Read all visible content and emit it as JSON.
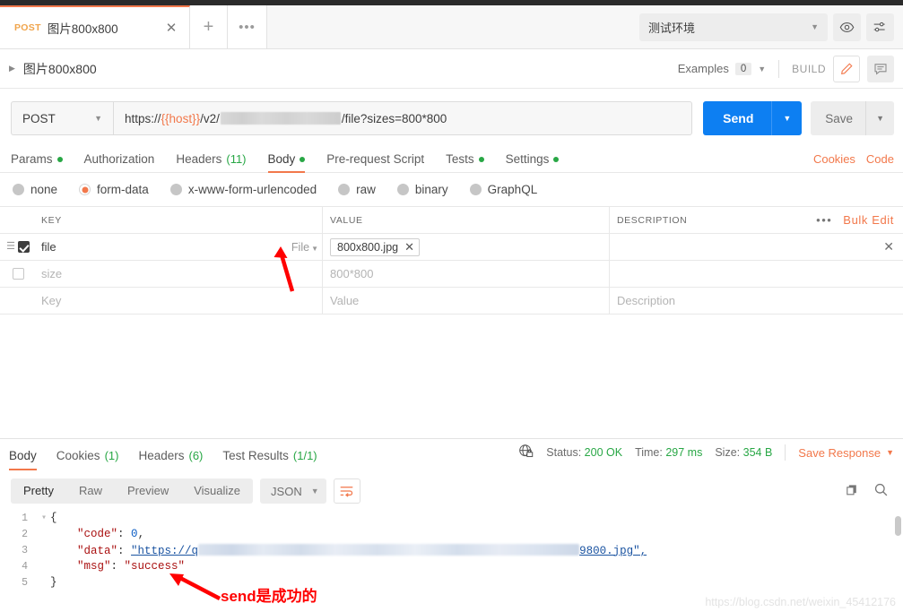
{
  "window": {
    "tab": {
      "method": "POST",
      "title": "图片800x800",
      "close_icon": "close-icon",
      "new_tab_icon": "plus-icon",
      "more_icon": "ellipsis-icon"
    },
    "environment": {
      "selected": "测试环境",
      "eye_icon": "eye-icon",
      "settings_icon": "sliders-icon"
    }
  },
  "breadcrumb": {
    "label": "图片800x800",
    "examples_label": "Examples",
    "examples_count": "0",
    "build_label": "BUILD",
    "edit_icon": "pencil-icon",
    "comment_icon": "comment-icon"
  },
  "request": {
    "method": "POST",
    "url_prefix": "https://",
    "url_var": "{{host}}",
    "url_mid": "/v2/",
    "url_suffix": "/file?sizes=800*800",
    "send_label": "Send",
    "save_label": "Save",
    "tabs": [
      {
        "label": "Params",
        "dot": true,
        "count": "",
        "active": false
      },
      {
        "label": "Authorization",
        "dot": false,
        "count": "",
        "active": false
      },
      {
        "label": "Headers",
        "dot": false,
        "count": "(11)",
        "active": false
      },
      {
        "label": "Body",
        "dot": true,
        "count": "",
        "active": true
      },
      {
        "label": "Pre-request Script",
        "dot": false,
        "count": "",
        "active": false
      },
      {
        "label": "Tests",
        "dot": true,
        "count": "",
        "active": false
      },
      {
        "label": "Settings",
        "dot": true,
        "count": "",
        "active": false
      }
    ],
    "links": [
      "Cookies",
      "Code"
    ],
    "body_modes": [
      {
        "label": "none",
        "selected": false
      },
      {
        "label": "form-data",
        "selected": true
      },
      {
        "label": "x-www-form-urlencoded",
        "selected": false
      },
      {
        "label": "raw",
        "selected": false
      },
      {
        "label": "binary",
        "selected": false
      },
      {
        "label": "GraphQL",
        "selected": false
      }
    ],
    "table": {
      "headers": {
        "key": "KEY",
        "value": "VALUE",
        "description": "DESCRIPTION"
      },
      "bulk_edit": "Bulk Edit",
      "rows": [
        {
          "checked": true,
          "key": "file",
          "type": "File",
          "value": "800x800.jpg",
          "is_file": true,
          "description": ""
        },
        {
          "checked": false,
          "key": "size",
          "type": "",
          "value": "800*800",
          "is_file": false,
          "description": ""
        }
      ],
      "placeholder_row": {
        "key": "Key",
        "value": "Value",
        "description": "Description"
      }
    }
  },
  "response": {
    "tabs": [
      {
        "label": "Body",
        "count": "",
        "active": true
      },
      {
        "label": "Cookies",
        "count": "(1)",
        "active": false
      },
      {
        "label": "Headers",
        "count": "(6)",
        "active": false
      },
      {
        "label": "Test Results",
        "count": "(1/1)",
        "active": false
      }
    ],
    "status_label": "Status:",
    "status_value": "200 OK",
    "time_label": "Time:",
    "time_value": "297 ms",
    "size_label": "Size:",
    "size_value": "354 B",
    "save_response": "Save Response",
    "globe_icon": "globe-lock-icon",
    "view_modes": [
      {
        "label": "Pretty",
        "active": true
      },
      {
        "label": "Raw",
        "active": false
      },
      {
        "label": "Preview",
        "active": false
      },
      {
        "label": "Visualize",
        "active": false
      }
    ],
    "format": "JSON",
    "wrap_icon": "word-wrap-icon",
    "copy_icon": "copy-icon",
    "search_icon": "search-icon",
    "body_lines": [
      {
        "n": "1",
        "text": "{"
      },
      {
        "n": "2",
        "key": "\"code\"",
        "sep": ": ",
        "value": "0",
        "tail": ","
      },
      {
        "n": "3",
        "key": "\"data\"",
        "sep": ": ",
        "value": "\"https://q",
        "tail": "9800.jpg\","
      },
      {
        "n": "4",
        "key": "\"msg\"",
        "sep": ": ",
        "value": "\"success\"",
        "tail": ""
      },
      {
        "n": "5",
        "text": "}"
      }
    ]
  },
  "annotations": {
    "note_text": "send是成功的",
    "watermark": "https://blog.csdn.net/weixin_45412176"
  }
}
